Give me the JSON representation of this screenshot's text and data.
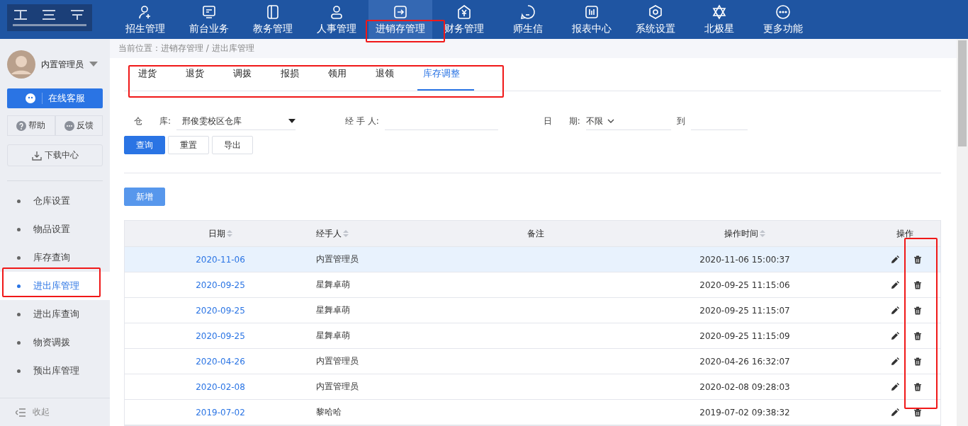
{
  "top_nav": {
    "items": [
      {
        "label": "招生管理",
        "selected": false
      },
      {
        "label": "前台业务",
        "selected": false
      },
      {
        "label": "教务管理",
        "selected": false
      },
      {
        "label": "人事管理",
        "selected": false
      },
      {
        "label": "进销存管理",
        "selected": true
      },
      {
        "label": "财务管理",
        "selected": false
      },
      {
        "label": "师生信",
        "selected": false
      },
      {
        "label": "报表中心",
        "selected": false
      },
      {
        "label": "系统设置",
        "selected": false
      },
      {
        "label": "北极星",
        "selected": false
      },
      {
        "label": "更多功能",
        "selected": false
      }
    ]
  },
  "sidebar": {
    "user": "内置管理员",
    "service_button": "在线客服",
    "help_button": "帮助",
    "feedback_button": "反馈",
    "download_button": "下载中心",
    "items": [
      {
        "label": "仓库设置",
        "selected": false
      },
      {
        "label": "物品设置",
        "selected": false
      },
      {
        "label": "库存查询",
        "selected": false
      },
      {
        "label": "进出库管理",
        "selected": true
      },
      {
        "label": "进出库查询",
        "selected": false
      },
      {
        "label": "物资调拨",
        "selected": false
      },
      {
        "label": "预出库管理",
        "selected": false
      }
    ],
    "collapse": "收起"
  },
  "breadcrumb": "当前位置：进销存管理 / 进出库管理",
  "tabs": [
    {
      "label": "进货",
      "selected": false
    },
    {
      "label": "退货",
      "selected": false
    },
    {
      "label": "调拨",
      "selected": false
    },
    {
      "label": "报损",
      "selected": false
    },
    {
      "label": "领用",
      "selected": false
    },
    {
      "label": "退领",
      "selected": false
    },
    {
      "label": "库存调整",
      "selected": true
    }
  ],
  "filters": {
    "warehouse_label": "仓　　库:",
    "warehouse_value": "邢俊雯校区仓库",
    "handler_label": "经 手 人:",
    "date_label": "日　　期:",
    "date_range": "不限",
    "to_label": "到"
  },
  "buttons": {
    "query": "查询",
    "reset": "重置",
    "export": "导出",
    "add": "新增"
  },
  "table": {
    "columns": [
      {
        "label": "日期",
        "sortable": true
      },
      {
        "label": "经手人",
        "sortable": true
      },
      {
        "label": "备注",
        "sortable": false
      },
      {
        "label": "操作时间",
        "sortable": true
      },
      {
        "label": "操作",
        "sortable": false
      }
    ],
    "rows": [
      {
        "date": "2020-11-06",
        "handler": "内置管理员",
        "time": "2020-11-06 15:00:37",
        "selected": true
      },
      {
        "date": "2020-09-25",
        "handler": "星舞卓萌",
        "time": "2020-09-25 11:15:06",
        "selected": false
      },
      {
        "date": "2020-09-25",
        "handler": "星舞卓萌",
        "time": "2020-09-25 11:15:07",
        "selected": false
      },
      {
        "date": "2020-09-25",
        "handler": "星舞卓萌",
        "time": "2020-09-25 11:15:09",
        "selected": false
      },
      {
        "date": "2020-04-26",
        "handler": "内置管理员",
        "time": "2020-04-26 16:32:07",
        "selected": false
      },
      {
        "date": "2020-02-08",
        "handler": "内置管理员",
        "time": "2020-02-08 09:28:03",
        "selected": false
      },
      {
        "date": "2019-07-02",
        "handler": "黎哈哈",
        "time": "2019-07-02 09:38:32",
        "selected": false
      }
    ]
  }
}
